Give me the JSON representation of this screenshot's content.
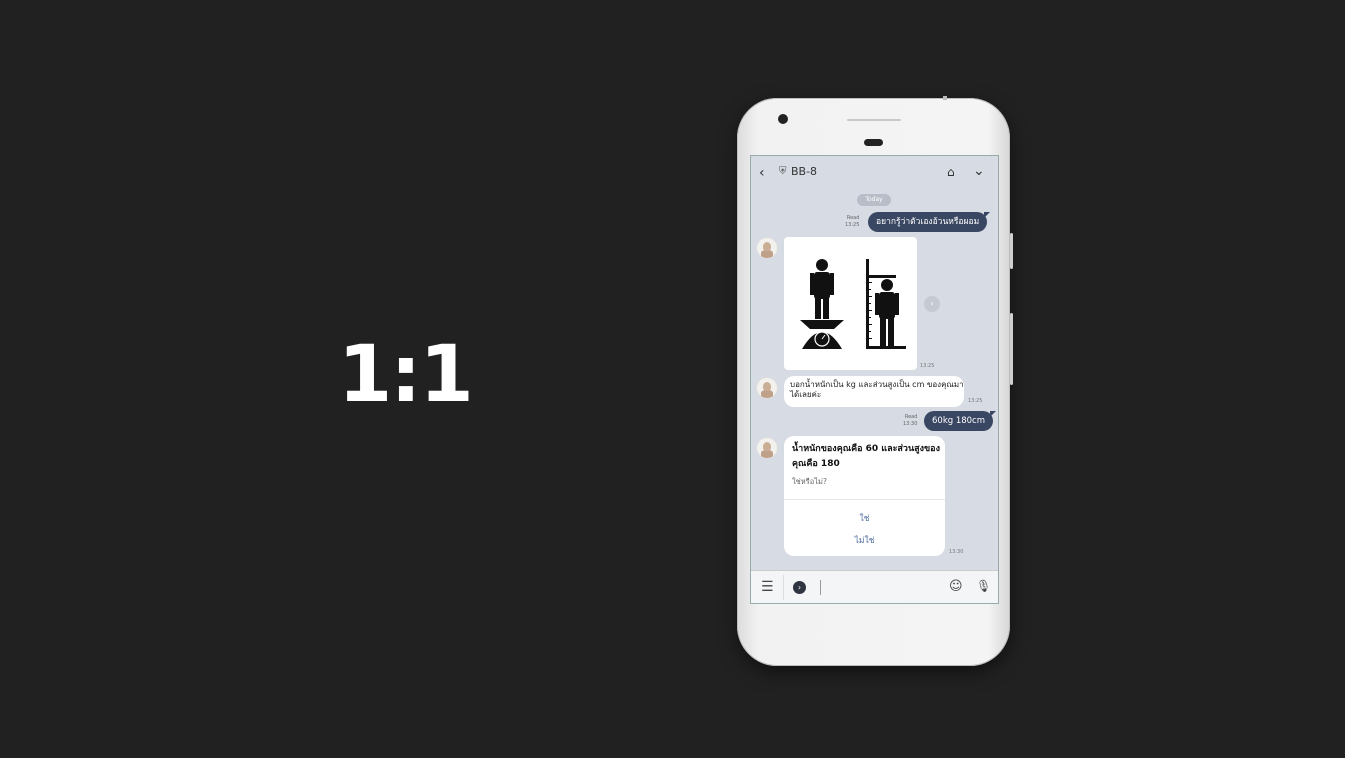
{
  "overlay": {
    "ratio_label": "1:1"
  },
  "chat": {
    "header": {
      "bot_name": "BB-8",
      "back_icon": "chevron-left-icon",
      "verified_icon": "shield-icon",
      "home_icon": "home-icon",
      "menu_icon": "chevron-down-icon"
    },
    "date_chip": "Today",
    "messages": [
      {
        "direction": "out",
        "text": "อยากรู้ว่าตัวเองอ้วนหรือผอม",
        "read": "Read",
        "time": "13:25"
      },
      {
        "direction": "in",
        "type": "image",
        "image": "weight-height-scale-image",
        "time": "13:25"
      },
      {
        "direction": "in",
        "text": "บอกน้ำหนักเป็น kg และส่วนสูงเป็น cm ของคุณมาได้เลยค่ะ",
        "time": "13:25"
      },
      {
        "direction": "out",
        "text": "60kg 180cm",
        "read": "Read",
        "time": "13:30"
      },
      {
        "direction": "in",
        "type": "confirm",
        "title": "น้ำหนักของคุณคือ 60 และส่วนสูงของคุณคือ 180",
        "subtitle": "ใช่หรือไม่?",
        "options": [
          "ใช่",
          "ไม่ใช่"
        ],
        "time": "13:30"
      }
    ],
    "input_bar": {
      "menu_icon": "list-menu-icon",
      "toggle_icon": "chevron-right-circle-icon",
      "emoji_icon": "smile-icon",
      "mic_icon": "mic-icon"
    }
  }
}
